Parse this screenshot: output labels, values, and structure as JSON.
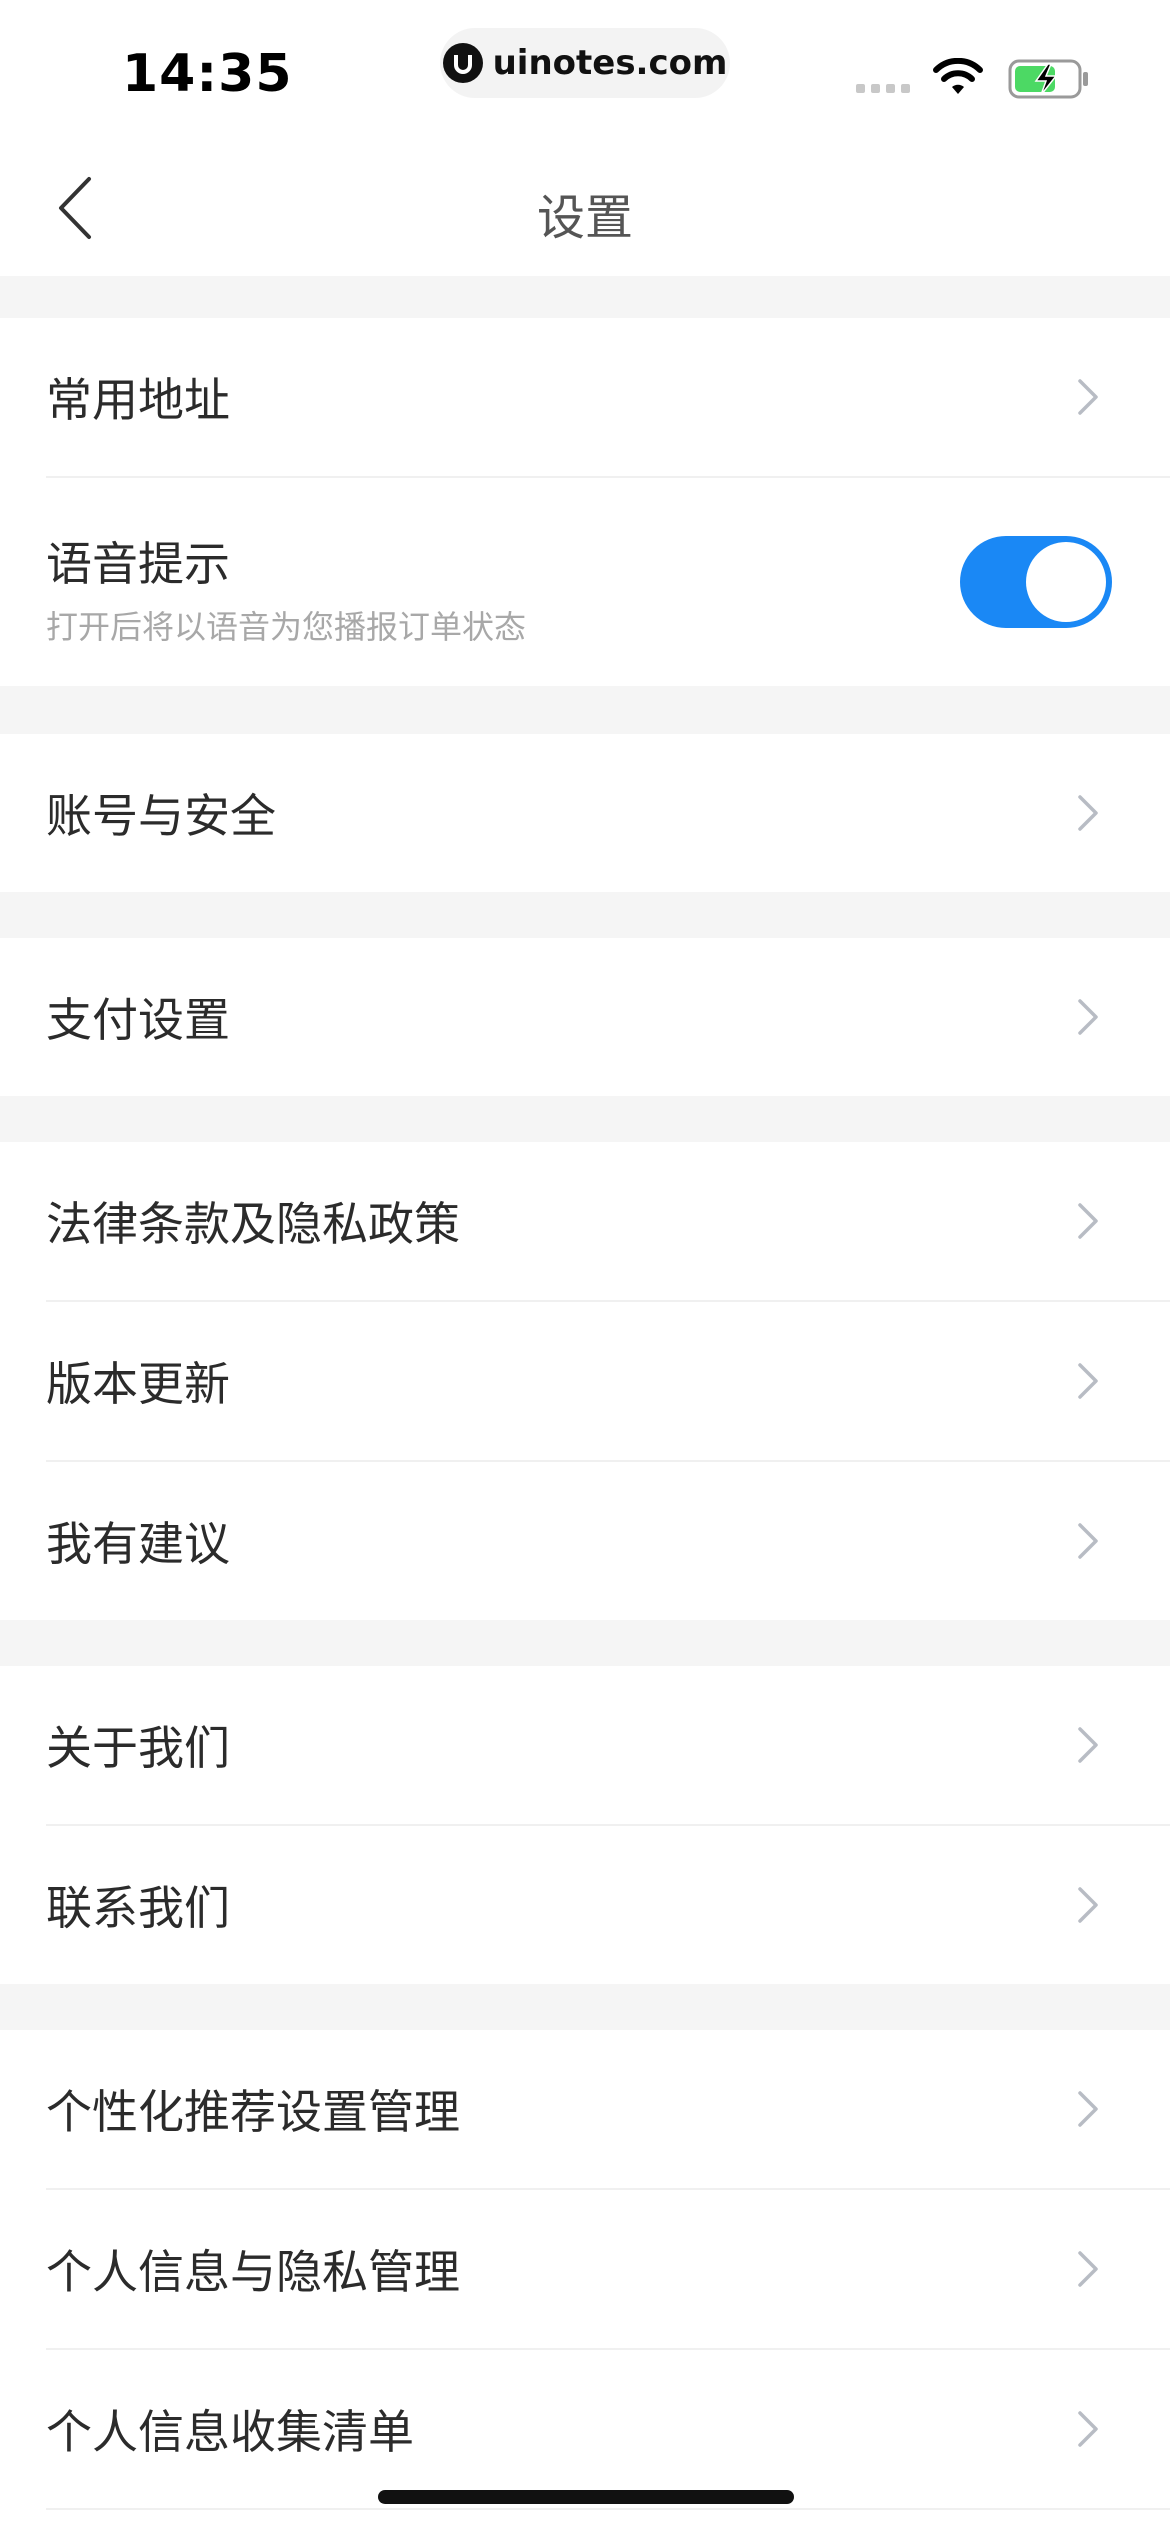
{
  "status_bar": {
    "time": "14:35",
    "url": "uinotes.com"
  },
  "nav": {
    "title": "设置"
  },
  "settings": {
    "common_address": "常用地址",
    "voice_prompt": {
      "title": "语音提示",
      "subtitle": "打开后将以语音为您播报订单状态",
      "enabled": true
    },
    "account_security": "账号与安全",
    "payment_settings": "支付设置",
    "legal_privacy": "法律条款及隐私政策",
    "version_update": "版本更新",
    "suggestions": "我有建议",
    "about_us": "关于我们",
    "contact_us": "联系我们",
    "personalized_recommendation": "个性化推荐设置管理",
    "personal_info_privacy": "个人信息与隐私管理",
    "personal_info_list": "个人信息收集清单"
  },
  "colors": {
    "accent": "#1a88f5",
    "section_gap": "#f5f5f5",
    "chevron": "#b8bcc4"
  },
  "icons": {
    "back": "chevron-left-icon",
    "row_arrow": "chevron-right-icon",
    "wifi": "wifi-icon",
    "battery": "battery-charging-icon"
  }
}
